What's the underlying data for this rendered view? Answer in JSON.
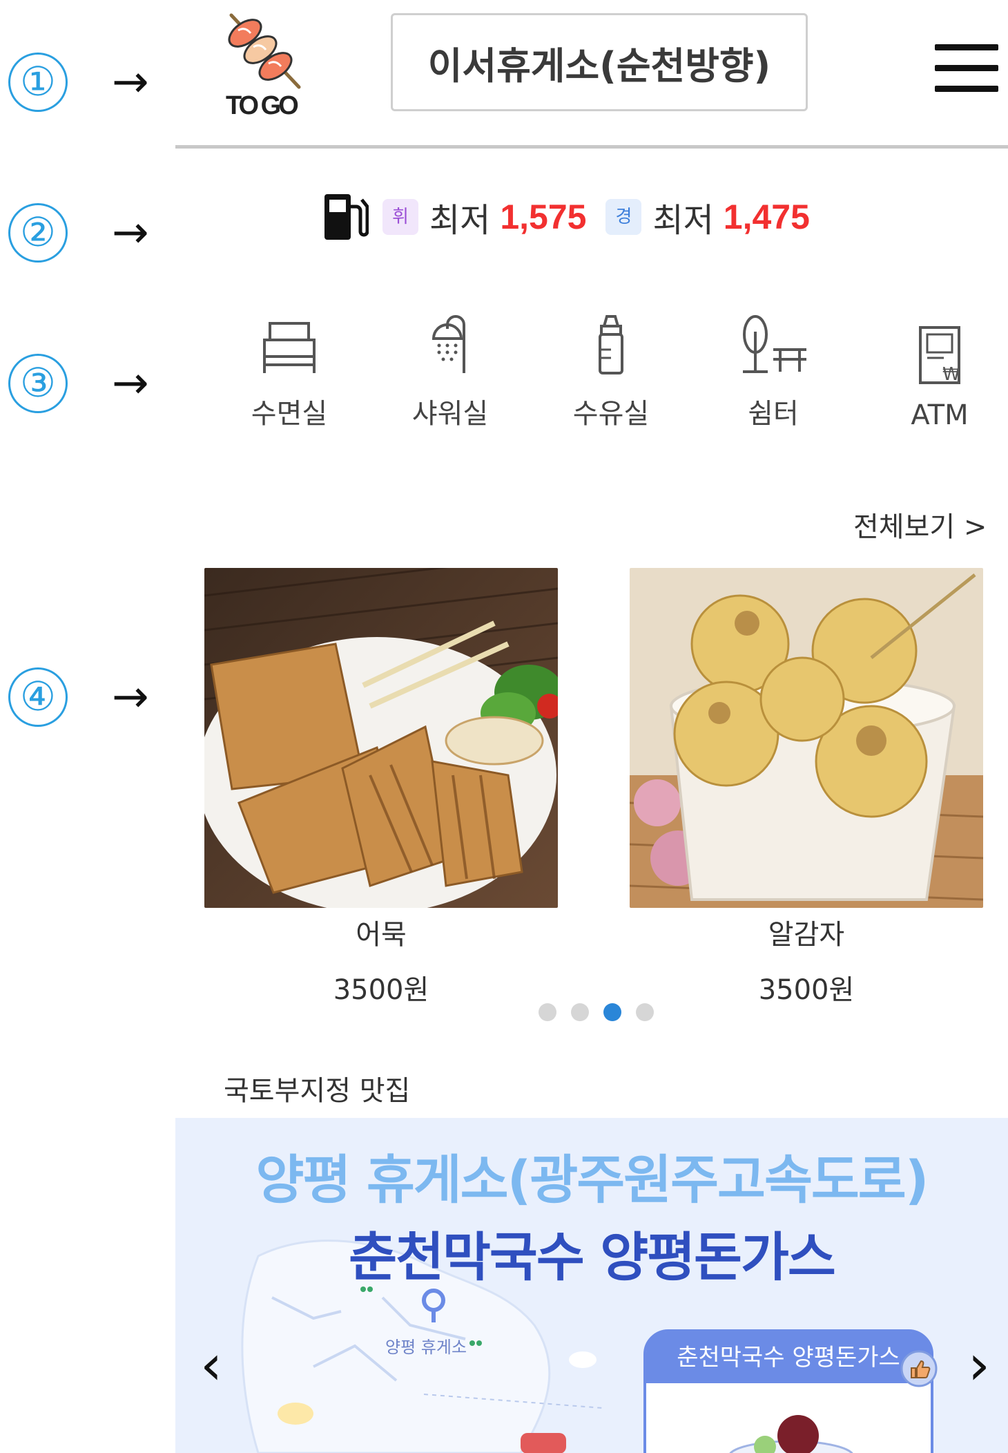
{
  "markers": [
    "①",
    "②",
    "③",
    "④"
  ],
  "marker_arrow": "→",
  "header": {
    "logo_text": "TO GO",
    "station_name": "이서휴게소(순천방향)"
  },
  "fuel": {
    "gasoline_badge": "휘",
    "gasoline_label": "최저",
    "gasoline_price": "1,575",
    "diesel_badge": "경",
    "diesel_label": "최저",
    "diesel_price": "1,475"
  },
  "amenities": [
    {
      "label": "수면실",
      "icon": "bed-icon"
    },
    {
      "label": "샤워실",
      "icon": "shower-icon"
    },
    {
      "label": "수유실",
      "icon": "baby-bottle-icon"
    },
    {
      "label": "쉼터",
      "icon": "rest-area-icon"
    },
    {
      "label": "ATM",
      "icon": "atm-icon"
    }
  ],
  "view_all": "전체보기 >",
  "products": [
    {
      "name": "어묵",
      "price": "3500원"
    },
    {
      "name": "알감자",
      "price": "3500원"
    }
  ],
  "carousel": {
    "count": 4,
    "active_index": 2
  },
  "section_title": "국토부지정 맛집",
  "banner": {
    "line1": "양평 휴게소(광주원주고속도로)",
    "line2": "춘천막국수 양평돈가스",
    "map_label": "양평 휴게소",
    "card_title": "춘천막국수 양평돈가스",
    "prev": "‹",
    "next": "›"
  },
  "colors": {
    "accent": "#2a9fe0",
    "price_red": "#f23030",
    "dot_active": "#2a86d8",
    "banner_bg": "#e9f0fd"
  }
}
